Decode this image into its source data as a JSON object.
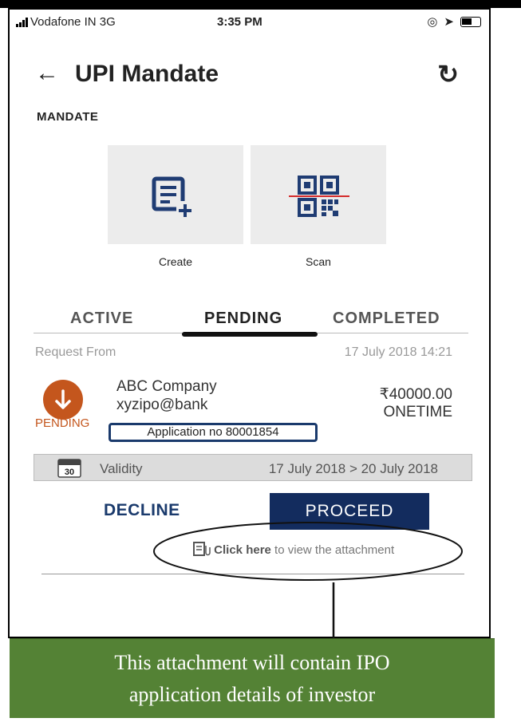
{
  "status_bar": {
    "carrier": "Vodafone IN  3G",
    "time": "3:35 PM"
  },
  "header": {
    "back_icon": "arrow-left-icon",
    "title": "UPI Mandate",
    "refresh_icon": "refresh-icon"
  },
  "section_title": "MANDATE",
  "actions": [
    {
      "label": "Create",
      "icon": "create-document-icon"
    },
    {
      "label": "Scan",
      "icon": "qr-scan-icon"
    }
  ],
  "tabs": [
    "ACTIVE",
    "PENDING",
    "COMPLETED"
  ],
  "selected_tab": "PENDING",
  "request": {
    "from_label": "Request From",
    "date": "17 July 2018 14:21",
    "status": "PENDING",
    "company": "ABC Company",
    "vpa": "xyzipo@bank",
    "amount": "₹40000.00",
    "frequency": "ONETIME",
    "application_no": "Application no 80001854",
    "validity_icon_text": "30",
    "validity_label": "Validity",
    "validity_range": "17 July 2018 > 20 July 2018"
  },
  "buttons": {
    "decline": "DECLINE",
    "proceed": "PROCEED"
  },
  "attachment": {
    "link": "Click here",
    "text": " to view the attachment"
  },
  "annotation": {
    "line1": "This attachment will contain IPO",
    "line2": "application details of investor"
  },
  "colors": {
    "status_orange": "#c4561d",
    "navy": "#132c5e",
    "callout_green": "#548235"
  }
}
